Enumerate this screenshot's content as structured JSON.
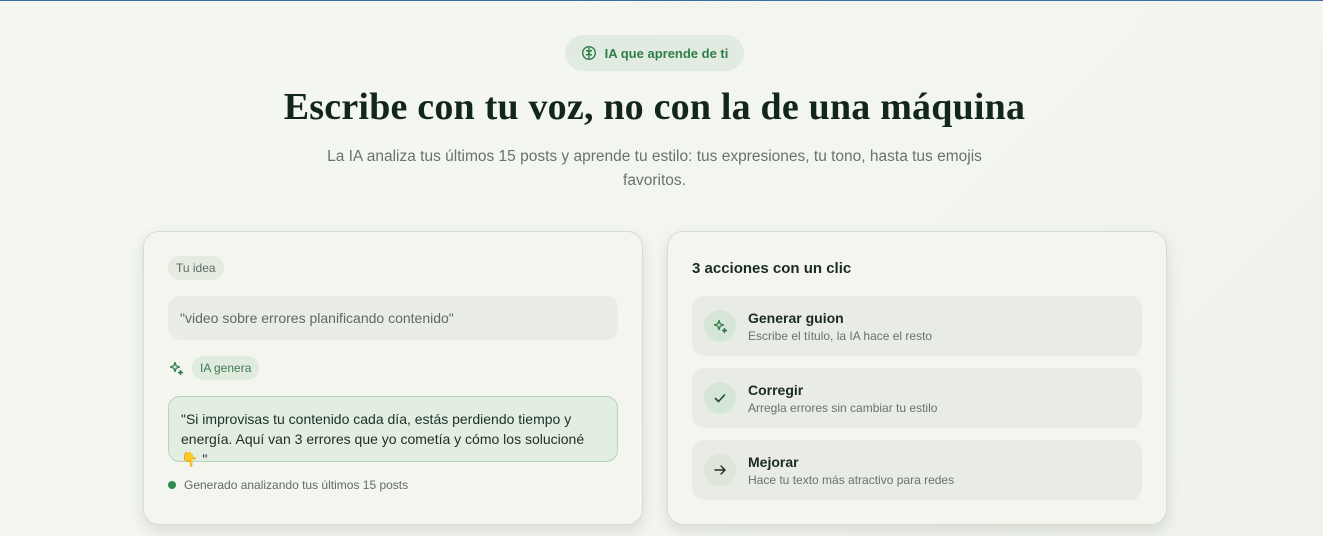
{
  "badge": {
    "label": "IA que aprende de ti",
    "icon": "brain-icon"
  },
  "hero": {
    "title": "Escribe con tu voz, no con la de una máquina",
    "subtitle": "La IA analiza tus últimos 15 posts y aprende tu estilo: tus expresiones, tu tono, hasta tus emojis favoritos."
  },
  "demo_card": {
    "idea_chip": "Tu idea",
    "idea_text": "\"video sobre errores planificando contenido\"",
    "generate_chip": "IA genera",
    "generated_text": "\"Si improvisas tu contenido cada día, estás perdiendo tiempo y energía. Aquí van 3 errores que yo cometía y cómo los solucioné 👇 \"",
    "footnote": "Generado analizando tus últimos 15 posts"
  },
  "actions_card": {
    "title": "3 acciones con un clic",
    "actions": [
      {
        "label": "Generar guion",
        "description": "Escribe el título, la IA hace el resto",
        "icon": "sparkle-icon"
      },
      {
        "label": "Corregir",
        "description": "Arregla errores sin cambiar tu estilo",
        "icon": "check-icon"
      },
      {
        "label": "Mejorar",
        "description": "Hace tu texto más atractivo para redes",
        "icon": "arrow-right-icon"
      }
    ]
  },
  "colors": {
    "accent": "#2f7d4a",
    "background": "#f3f5ef",
    "title": "#13261b"
  }
}
